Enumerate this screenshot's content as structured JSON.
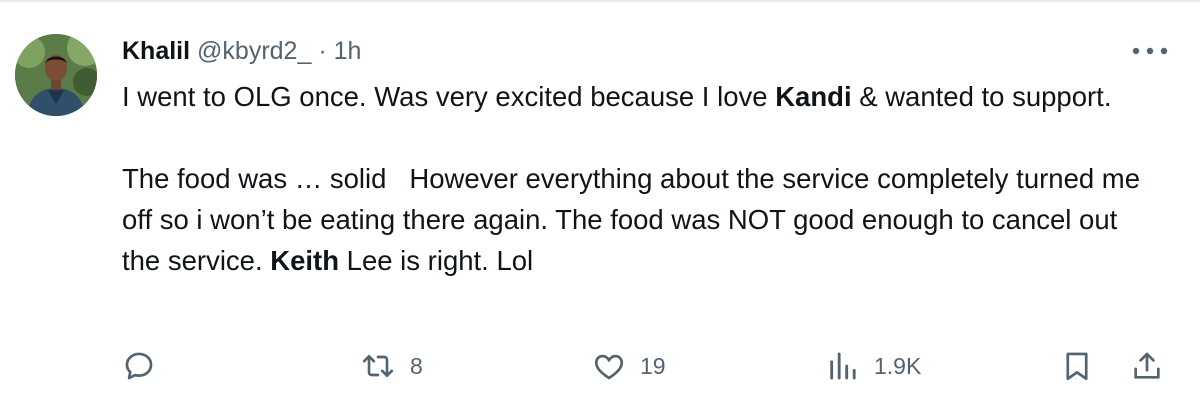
{
  "tweet": {
    "author": {
      "display_name": "Khalil",
      "handle": "@kbyrd2_",
      "separator": "·",
      "time": "1h"
    },
    "text": {
      "p1": {
        "a": "I went to OLG once. Was very excited because I love ",
        "bold": "Kandi",
        "b": " & wanted to support."
      },
      "p2": {
        "a": "The food was … solid   However everything about the service completely turned me off so i won’t be eating there again. The food was NOT good enough to cancel out the service. ",
        "bold": "Keith",
        "b": " Lee is right. Lol"
      }
    },
    "actions": {
      "reply": {
        "icon": "reply-icon",
        "count": ""
      },
      "retweet": {
        "icon": "retweet-icon",
        "count": "8"
      },
      "like": {
        "icon": "heart-icon",
        "count": "19"
      },
      "views": {
        "icon": "views-icon",
        "count": "1.9K"
      },
      "bookmark": {
        "icon": "bookmark-icon"
      },
      "share": {
        "icon": "share-icon"
      }
    }
  },
  "colors": {
    "text_primary": "#0f1419",
    "text_secondary": "#536471",
    "divider": "#e7e9ea"
  }
}
